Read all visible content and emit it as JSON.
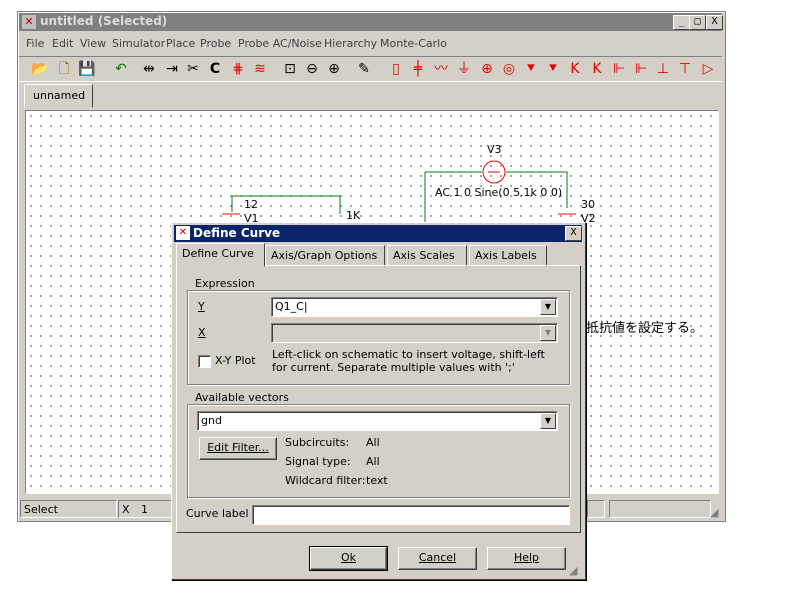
{
  "window": {
    "title": "untitled (Selected)",
    "controls": [
      "_",
      "□",
      "X"
    ]
  },
  "menu": [
    "File",
    "Edit",
    "View",
    "Simulator",
    "Place",
    "Probe",
    "Probe AC/Noise",
    "Hierarchy",
    "Monte-Carlo"
  ],
  "toolbar_icons": [
    "open-icon",
    "new-icon",
    "save-icon",
    "undo-icon",
    "mirror-icon",
    "rotate-icon",
    "cut-icon",
    "refresh-icon",
    "wire-icon",
    "bus-icon",
    "zoom-box-icon",
    "zoom-out-icon",
    "zoom-in-icon",
    "pencil-icon",
    "resistor-icon",
    "capacitor-icon",
    "inductor-icon",
    "ground-icon",
    "vsource-icon",
    "isource-icon",
    "diode-icon",
    "zener-icon",
    "npn-icon",
    "pnp-icon",
    "nmos-icon",
    "pmos-icon",
    "njfet-icon",
    "pjfet-icon",
    "opamp-icon"
  ],
  "tab": {
    "label": "unnamed"
  },
  "schematic": {
    "v3_label": "V3",
    "v3_value": "AC 1 0 Sine(0 5.1k 0 0)",
    "label_12": "12",
    "label_v1": "V1",
    "label_1k": "1K",
    "label_30": "30",
    "label_v2": "V2",
    "jp_text": "抵抗値を設定する。"
  },
  "status": {
    "mode": "Select",
    "x_label": "X",
    "x_value": "1"
  },
  "dialog": {
    "title": "Define Curve",
    "close": "X",
    "tabs": [
      "Define Curve",
      "Axis/Graph Options",
      "Axis Scales",
      "Axis Labels"
    ],
    "expression": {
      "group_label": "Expression",
      "y_label": "Y",
      "y_value": "Q1_C|",
      "x_label": "X",
      "x_value": "",
      "xy_plot_label": "X-Y Plot",
      "xy_plot_checked": false,
      "hint": "Left-click on schematic to insert voltage, shift-left for current. Separate multiple values with ';'"
    },
    "vectors": {
      "group_label": "Available vectors",
      "selected": "gnd",
      "edit_filter": "Edit Filter...",
      "subcircuits_label": "Subcircuits:",
      "subcircuits_value": "All",
      "signal_type_label": "Signal type:",
      "signal_type_value": "All",
      "wildcard_label": "Wildcard filter:",
      "wildcard_value": "text"
    },
    "curve_label": {
      "label": "Curve label",
      "value": ""
    },
    "buttons": {
      "ok": "Ok",
      "cancel": "Cancel",
      "help": "Help"
    }
  },
  "colors": {
    "title_active": "#0a246a",
    "title_inactive": "#808080",
    "wire": "#008000",
    "source": "#ff0000",
    "toolbar_red": "#ff0000"
  }
}
